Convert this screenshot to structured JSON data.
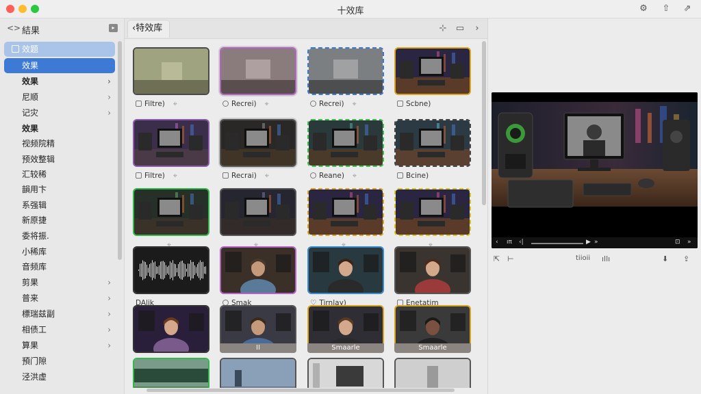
{
  "window": {
    "title": "十效库"
  },
  "titlebar_icons": [
    "gear-icon",
    "share-icon",
    "external-icon"
  ],
  "sidebar": {
    "back_label": "<>",
    "title": "結果",
    "items": [
      {
        "label": "效题",
        "state": "sel1"
      },
      {
        "label": "效果",
        "state": "sel2"
      },
      {
        "label": "效果",
        "bold": true,
        "chevron": true
      },
      {
        "label": "尼顺",
        "chevron": true
      },
      {
        "label": "记灾",
        "chevron": true
      },
      {
        "label": "效果",
        "bold": true
      },
      {
        "label": "视频院精"
      },
      {
        "label": "预效整辑"
      },
      {
        "label": "汇较稀"
      },
      {
        "label": "韻用卞"
      },
      {
        "label": "系强辑"
      },
      {
        "label": "新原捷"
      },
      {
        "label": "委将振."
      },
      {
        "label": "小稀库"
      },
      {
        "label": "音频库"
      },
      {
        "label": "剪果",
        "chevron": true
      },
      {
        "label": "普来",
        "chevron": true
      },
      {
        "label": "標瑞兹副",
        "chevron": true
      },
      {
        "label": "相债工",
        "chevron": true
      },
      {
        "label": "算果",
        "chevron": true
      },
      {
        "label": "預门隙"
      },
      {
        "label": "泾洪虚"
      }
    ]
  },
  "center": {
    "tab_label": "特效库",
    "tab_prefix": "‹",
    "tiles": [
      {
        "label": "Filtre)",
        "icon": "square",
        "pin": true,
        "style": "fog",
        "border": "#4a4a4a"
      },
      {
        "label": "Recrei)",
        "icon": "round",
        "pin": true,
        "style": "fog-pink",
        "border": "#b463c4",
        "selected": true
      },
      {
        "label": "Recrei)",
        "icon": "round",
        "pin": true,
        "style": "fog-grey",
        "border": "#3a7ad0",
        "dashed": true
      },
      {
        "label": "Scbne)",
        "icon": "square",
        "pin": false,
        "style": "desk",
        "border": "#d9a520"
      },
      {
        "label": "Filtre)",
        "icon": "square",
        "pin": true,
        "style": "desk-purple",
        "border": "#8a5ba8"
      },
      {
        "label": "Recrai)",
        "icon": "square",
        "pin": true,
        "style": "desk-dark",
        "border": "#555",
        "selected": true
      },
      {
        "label": "Reane)",
        "icon": "round",
        "pin": true,
        "style": "desk-teal",
        "border": "#3bbf4d",
        "dashed": true
      },
      {
        "label": "Bcine)",
        "icon": "square",
        "pin": false,
        "style": "desk-cyan",
        "border": "#444",
        "dashed": true
      },
      {
        "label": "",
        "pin_only": true,
        "style": "desk-green",
        "border": "#31b84a"
      },
      {
        "label": "",
        "pin_only": true,
        "style": "desk-dim",
        "border": "#555"
      },
      {
        "label": "",
        "pin_only": true,
        "style": "desk",
        "border": "#d9a520",
        "dashed": true
      },
      {
        "label": "",
        "pin_only": true,
        "style": "desk",
        "border": "#d9c320",
        "dashed": true
      },
      {
        "label": "DAlik",
        "icon": "none",
        "style": "wave",
        "border": "#333"
      },
      {
        "label": "Smak",
        "icon": "round",
        "style": "man",
        "border": "#b463c4"
      },
      {
        "label": "Tirnlay)",
        "icon": "heart",
        "style": "woman-teal",
        "border": "#3a8bd0"
      },
      {
        "label": "Enetatim",
        "icon": "square",
        "style": "woman-plaid",
        "border": "#555"
      },
      {
        "caption": "",
        "style": "woman-purple",
        "border": "#333"
      },
      {
        "caption": "II",
        "style": "man-studio",
        "border": "#555"
      },
      {
        "caption": "Smaarle",
        "style": "woman-studio",
        "border": "#d9a520"
      },
      {
        "caption": "Smaarle",
        "style": "man-dark",
        "border": "#d9a520"
      },
      {
        "caption": "",
        "style": "landscape-green",
        "border": "#31b84a"
      },
      {
        "caption": "",
        "style": "landscape",
        "border": "#555"
      },
      {
        "caption": "",
        "style": "room",
        "border": "#555"
      },
      {
        "caption": "",
        "style": "statue",
        "border": "#555"
      }
    ]
  },
  "viewer": {
    "label": "tiioii",
    "controls": [
      "‹",
      "ıπ",
      "‹|",
      "▶",
      "»",
      "⊡",
      "»"
    ]
  },
  "colors": {
    "accent": "#3d7ad6",
    "selection_light": "#a9c4e8"
  }
}
